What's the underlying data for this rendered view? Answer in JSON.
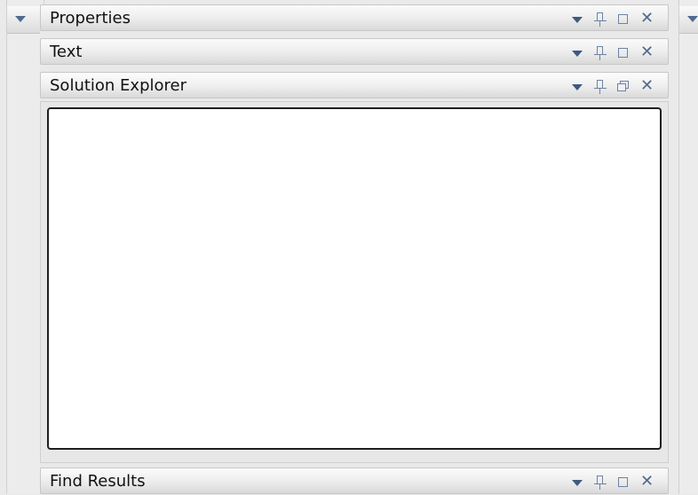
{
  "panels": [
    {
      "title": "Properties",
      "maximize_icon": "maximize-icon"
    },
    {
      "title": "Text",
      "maximize_icon": "maximize-icon"
    },
    {
      "title": "Solution Explorer",
      "maximize_icon": "restore-icon"
    },
    {
      "title": "Find Results",
      "maximize_icon": "maximize-icon"
    }
  ],
  "icons": {
    "menu": "dropdown-arrow-icon",
    "pin": "pin-icon",
    "close": "close-icon",
    "close_glyph": "✕"
  },
  "colors": {
    "icon": "#3f5a7e",
    "content_border": "#1f1f1f",
    "content_bg": "#ffffff",
    "background": "#eaeaea"
  }
}
